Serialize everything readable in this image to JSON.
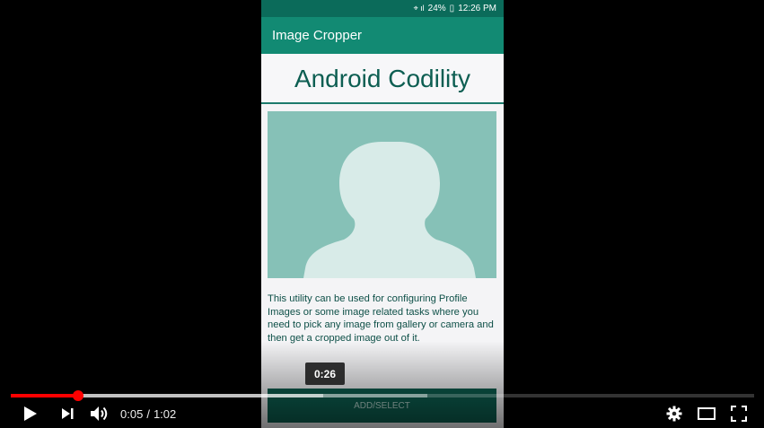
{
  "phone": {
    "status": {
      "battery": "24%",
      "time": "12:26 PM"
    },
    "app_title": "Image Cropper",
    "headline": "Android Codility",
    "description": "This utility can be used for configuring Profile Images or some image related tasks where you need to pick any image from gallery or camera and then get a cropped image out of it.",
    "button_label": "ADD/SELECT"
  },
  "player": {
    "preview_time": "0:26",
    "current_time": "0:05",
    "time_separator": "/",
    "duration": "1:02",
    "progress_played_fraction": 0.09,
    "progress_loaded_fraction": 0.56,
    "progress_hover_fraction": 0.42
  },
  "icons": {
    "play": "play-icon",
    "next": "next-icon",
    "volume": "volume-icon",
    "settings": "gear-icon",
    "theater": "theater-mode-icon",
    "fullscreen": "fullscreen-icon"
  },
  "colors": {
    "progress_played": "#ff0000",
    "app_bar": "#128a73",
    "headline": "#0d5e52"
  }
}
